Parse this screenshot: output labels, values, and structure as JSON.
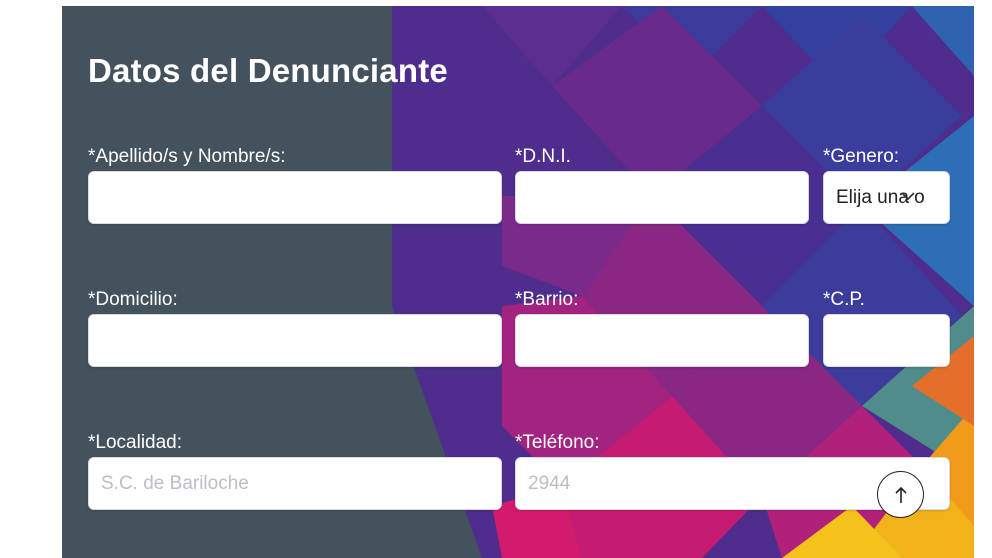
{
  "form": {
    "title": "Datos del Denunciante",
    "fields": {
      "apellido": {
        "label": "*Apellido/s y Nombre/s:",
        "value": ""
      },
      "dni": {
        "label": "*D.N.I.",
        "value": ""
      },
      "genero": {
        "label": "*Genero:",
        "selected": "Elija una o"
      },
      "domicilio": {
        "label": "*Domicilio:",
        "value": ""
      },
      "barrio": {
        "label": "*Barrio:",
        "value": ""
      },
      "cp": {
        "label": "*C.P.",
        "value": ""
      },
      "localidad": {
        "label": "*Localidad:",
        "placeholder": "S.C. de Bariloche"
      },
      "telefono": {
        "label": "*Teléfono:",
        "placeholder": "2944"
      }
    }
  },
  "icons": {
    "chevron": "chevron-down-icon",
    "scroll_top": "arrow-up-icon"
  },
  "colors": {
    "panel": "#43525c",
    "purple": "#5a2a8a",
    "magenta": "#c21a7a",
    "blue": "#2a5aa8",
    "orange": "#f29a1a",
    "yellow": "#f4c21a"
  }
}
